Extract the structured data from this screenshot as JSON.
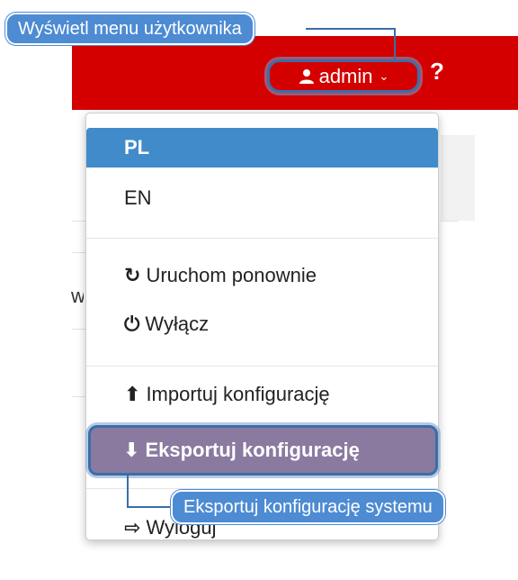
{
  "header": {
    "user_label": "admin",
    "user_icon": "user-icon",
    "chevron_icon": "chevron-down-icon",
    "help_label": "?"
  },
  "menu": {
    "languages": [
      "PL",
      "EN"
    ],
    "selected_language": "PL",
    "restart": {
      "icon": "refresh-icon",
      "label": "Uruchom ponownie"
    },
    "shutdown": {
      "icon": "power-icon",
      "label": "Wyłącz"
    },
    "import": {
      "icon": "arrow-up-circle-icon",
      "label": "Importuj konfigurację"
    },
    "export": {
      "icon": "arrow-down-circle-icon",
      "label": "Eksportuj konfigurację"
    },
    "logout": {
      "icon": "sign-out-icon",
      "label": "Wyloguj"
    }
  },
  "tooltips": {
    "user_menu": "Wyświetl menu użytkownika",
    "export": "Eksportuj konfigurację systemu"
  },
  "background": {
    "cut_text": "w"
  },
  "colors": {
    "header_bg": "#d40000",
    "selected_bg": "#428bca",
    "highlight_bg": "#8a7aa0",
    "tooltip_bg": "#4d8bd3",
    "highlight_border": "#3b6ea8"
  }
}
